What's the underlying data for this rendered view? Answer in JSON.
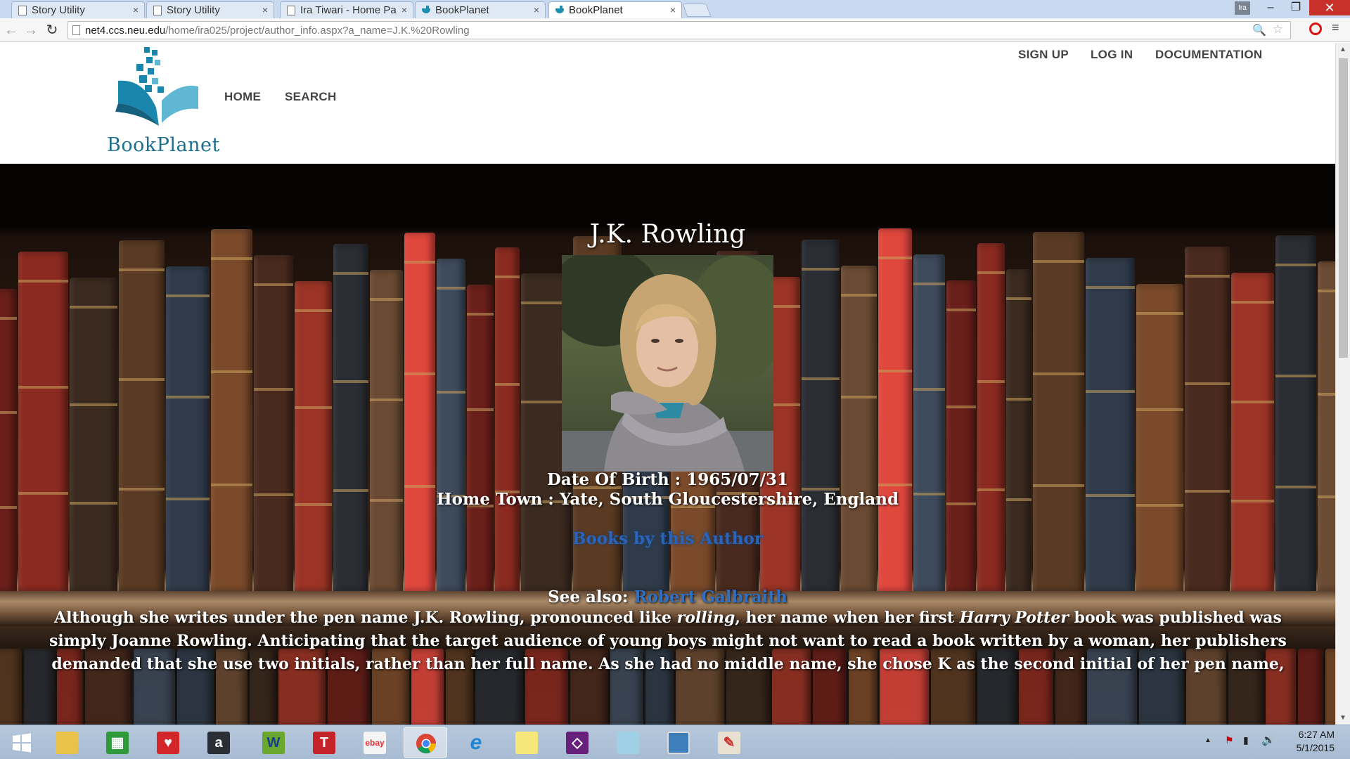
{
  "browser": {
    "tabs": [
      {
        "title": "Story Utility",
        "close": "×"
      },
      {
        "title": "Story Utility",
        "close": "×"
      },
      {
        "title": "Ira Tiwari - Home Pa",
        "close": "×"
      },
      {
        "title": "BookPlanet",
        "close": "×"
      },
      {
        "title": "BookPlanet",
        "close": "×"
      }
    ],
    "profile_label": "Ira",
    "window_buttons": {
      "minimize": "–",
      "restore": "❐",
      "close": "✕"
    },
    "url_host": "net4.ccs.neu.edu",
    "url_path": "/home/ira025/project/author_info.aspx?a_name=J.K.%20Rowling",
    "nav": {
      "back": "←",
      "forward": "→",
      "reload": "↻"
    },
    "zoom_icon": "🔍",
    "star_icon": "☆",
    "menu_icon": "≡"
  },
  "site": {
    "brand": "BookPlanet",
    "nav_left": [
      "HOME",
      "SEARCH"
    ],
    "nav_right": [
      "SIGN UP",
      "LOG IN",
      "DOCUMENTATION"
    ]
  },
  "author": {
    "name": "J.K. Rowling",
    "dob_label": "Date Of Birth : ",
    "dob": "1965/07/31",
    "hometown_label": "Home Town : ",
    "hometown": "Yate, South Gloucestershire, England",
    "books_link": "Books by this Author",
    "see_also_label": "See also: ",
    "see_also_link": "Robert Galbraith",
    "bio": {
      "p1": "Although she writes under the pen name J.K. Rowling, pronounced like ",
      "em1": "rolling",
      "p2": ", her name when her first ",
      "em2": "Harry Potter",
      "p3": " book was published was simply Joanne Rowling. Anticipating that the target audience of young boys might not want to read a book written by a woman, her publishers demanded that she use two initials, rather than her full name. As she had no middle name, she chose K as the second initial of her pen name,"
    }
  },
  "taskbar": {
    "apps": [
      "start",
      "file-explorer",
      "store",
      "heart-app",
      "amazon",
      "games",
      "t-app",
      "ebay",
      "chrome",
      "internet-explorer",
      "sticky-notes",
      "visual-studio",
      "notepad",
      "photos",
      "paint"
    ],
    "amazon_glyph": "a",
    "t_glyph": "T",
    "ebay_text": "ebay",
    "games_glyph": "W",
    "clock_time": "6:27 AM",
    "clock_date": "5/1/2015"
  },
  "colors": {
    "brand_teal": "#1b6f90",
    "link_blue": "#2f6fc4",
    "tab_strip": "#c9daf0",
    "close_red": "#c7312a"
  }
}
